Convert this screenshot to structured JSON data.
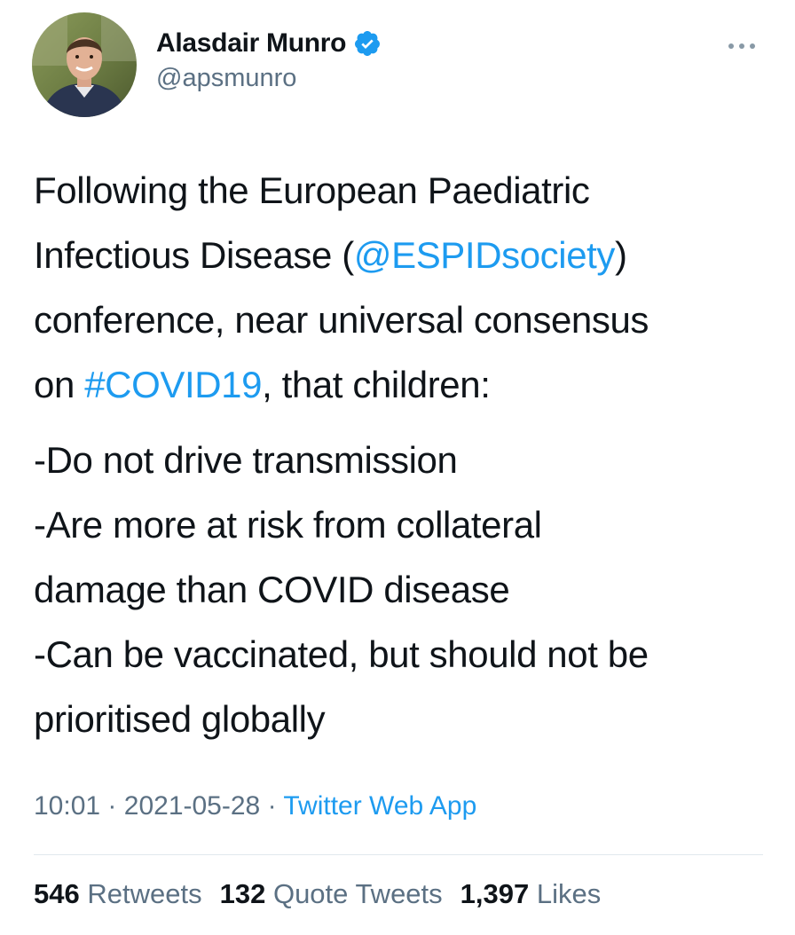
{
  "author": {
    "display_name": "Alasdair Munro",
    "handle": "@apsmunro",
    "verified": true
  },
  "tweet": {
    "line1_a": "Following the European Paediatric",
    "line2_a": "Infectious Disease (",
    "mention": "@ESPIDsociety",
    "line2_b": ")",
    "line3": "conference, near universal consensus",
    "line4_a": "on ",
    "hashtag": "#COVID19",
    "line4_b": ", that children:",
    "point1": "-Do not drive transmission",
    "point2_a": "-Are more at risk from collateral",
    "point2_b": "damage than COVID disease",
    "point3_a": "-Can be vaccinated, but should not be",
    "point3_b": "prioritised globally"
  },
  "meta": {
    "time": "10:01",
    "date": "2021-05-28",
    "separator": "·",
    "source": "Twitter Web App"
  },
  "stats": {
    "retweets_count": "546",
    "retweets_label": "Retweets",
    "quotes_count": "132",
    "quotes_label": "Quote Tweets",
    "likes_count": "1,397",
    "likes_label": "Likes"
  },
  "colors": {
    "link": "#1d9bf0",
    "secondary_text": "#5b7083",
    "primary_text": "#0f1419"
  },
  "icons": {
    "verified": "verified-badge-icon",
    "more": "more-horizontal-icon"
  }
}
